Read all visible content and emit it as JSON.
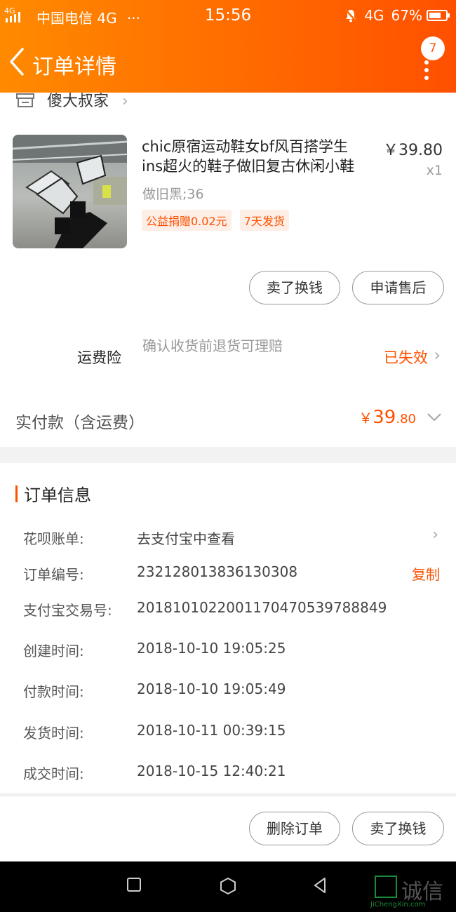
{
  "status_bar": {
    "network_small": "4G",
    "carrier": "中国电信 4G",
    "dots": "···",
    "time": "15:56",
    "network": "4G",
    "battery": "67%"
  },
  "nav": {
    "title": "订单详情",
    "badge_count": "7"
  },
  "shop": {
    "name": "傻大叔家",
    "chevron": "›"
  },
  "product": {
    "title_line1": "chic原宿运动鞋女bf风百搭学生",
    "title_line2": "ins超火的鞋子做旧复古休闲小鞋",
    "price": "￥39.80",
    "quantity": "x1",
    "sku": "做旧黑;36",
    "tags": [
      "公益捐赠0.02元",
      "7天发货"
    ]
  },
  "product_actions": {
    "sell_label": "卖了换钱",
    "after_sale_label": "申请售后"
  },
  "insurance": {
    "label": "运费险",
    "desc": "确认收货前退货可理赔",
    "status": "已失效",
    "chevron": "›"
  },
  "payment": {
    "label": "实付款（含运费）",
    "currency": "￥",
    "amount_int": "39",
    "amount_dec": ".80"
  },
  "order_info": {
    "section_title": "订单信息",
    "rows": [
      {
        "key": "花呗账单:",
        "value": "去支付宝中查看",
        "action": ""
      },
      {
        "key": "订单编号:",
        "value": "232128013836130308",
        "action": "复制"
      },
      {
        "key": "支付宝交易号:",
        "value": "2018101022001170470539788849",
        "action": ""
      },
      {
        "key": "创建时间:",
        "value": "2018-10-10 19:05:25",
        "action": ""
      },
      {
        "key": "付款时间:",
        "value": "2018-10-10 19:05:49",
        "action": ""
      },
      {
        "key": "发货时间:",
        "value": "2018-10-11 00:39:15",
        "action": ""
      },
      {
        "key": "成交时间:",
        "value": "2018-10-15 12:40:21",
        "action": ""
      }
    ]
  },
  "bottom_actions": {
    "delete_label": "删除订单",
    "sell_label": "卖了换钱"
  },
  "watermark": {
    "text": "诚信",
    "sub": "JiChengXin.com"
  },
  "colors": {
    "accent": "#ff5000",
    "header_gradient_start": "#ff8a00",
    "header_gradient_end": "#ff5000"
  }
}
